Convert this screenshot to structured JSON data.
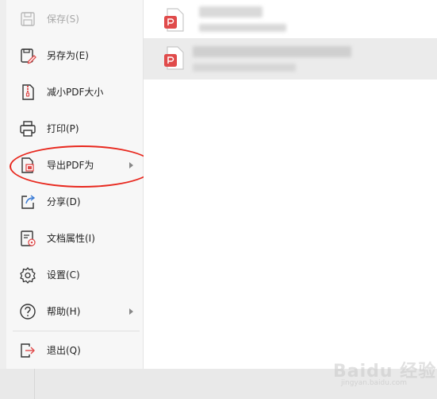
{
  "menu": {
    "items": [
      {
        "label": "保存(S)",
        "icon": "save-icon",
        "disabled": true,
        "submenu": false
      },
      {
        "label": "另存为(E)",
        "icon": "save-as-icon",
        "disabled": false,
        "submenu": false
      },
      {
        "label": "减小PDF大小",
        "icon": "compress-pdf-icon",
        "disabled": false,
        "submenu": false
      },
      {
        "label": "打印(P)",
        "icon": "printer-icon",
        "disabled": false,
        "submenu": false
      },
      {
        "label": "导出PDF为",
        "icon": "export-pdf-icon",
        "disabled": false,
        "submenu": true
      },
      {
        "label": "分享(D)",
        "icon": "share-icon",
        "disabled": false,
        "submenu": false
      },
      {
        "label": "文档属性(I)",
        "icon": "document-properties-icon",
        "disabled": false,
        "submenu": false
      },
      {
        "label": "设置(C)",
        "icon": "gear-icon",
        "disabled": false,
        "submenu": false
      },
      {
        "label": "帮助(H)",
        "icon": "help-icon",
        "disabled": false,
        "submenu": true
      },
      {
        "label": "退出(Q)",
        "icon": "exit-icon",
        "disabled": false,
        "submenu": false
      }
    ]
  },
  "recent_files": {
    "items": [
      {
        "icon": "pdf-file-icon",
        "selected": false
      },
      {
        "icon": "pdf-file-icon",
        "selected": true
      }
    ]
  },
  "watermark": {
    "text": "Baidu 经验",
    "sub": "jingyan.baidu.com"
  },
  "colors": {
    "accent_red": "#e04b4b",
    "highlight_red": "#e8281e",
    "menu_bg": "#f7f7f7",
    "content_bg": "#ffffff",
    "selected_row_bg": "#ebebeb"
  }
}
